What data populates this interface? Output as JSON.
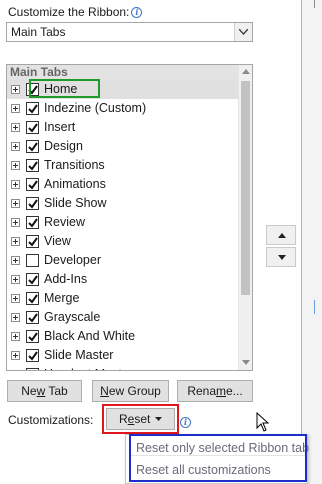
{
  "header": {
    "label": "Customize the Ribbon:"
  },
  "tabs_dropdown": {
    "value": "Main Tabs"
  },
  "tree": {
    "header": "Main Tabs",
    "items": [
      {
        "label": "Home",
        "checked": true
      },
      {
        "label": "Indezine (Custom)",
        "checked": true
      },
      {
        "label": "Insert",
        "checked": true
      },
      {
        "label": "Design",
        "checked": true
      },
      {
        "label": "Transitions",
        "checked": true
      },
      {
        "label": "Animations",
        "checked": true
      },
      {
        "label": "Slide Show",
        "checked": true
      },
      {
        "label": "Review",
        "checked": true
      },
      {
        "label": "View",
        "checked": true
      },
      {
        "label": "Developer",
        "checked": false
      },
      {
        "label": "Add-Ins",
        "checked": true
      },
      {
        "label": "Merge",
        "checked": true
      },
      {
        "label": "Grayscale",
        "checked": true
      },
      {
        "label": "Black And White",
        "checked": true
      },
      {
        "label": "Slide Master",
        "checked": true
      },
      {
        "label": "Handout Master",
        "checked": true
      }
    ]
  },
  "buttons": {
    "new_tab": {
      "mnemonic": "w",
      "pre": "Ne",
      "post": " Tab"
    },
    "new_group": {
      "mnemonic": "N",
      "pre": "",
      "post": "ew Group"
    },
    "rename": {
      "mnemonic": "m",
      "pre": "Rena",
      "post": "e..."
    }
  },
  "customizations": {
    "label": "Customizations:",
    "reset": {
      "pre": "R",
      "mnemonic": "e",
      "post": "set"
    }
  },
  "reset_menu": {
    "items": [
      "Reset only selected Ribbon tab",
      "Reset all customizations"
    ]
  },
  "colors": {
    "highlight_home": "#1f9a2e",
    "highlight_reset": "#e0181c",
    "highlight_menu": "#1e2ec8",
    "info_icon": "#3a77c8"
  }
}
